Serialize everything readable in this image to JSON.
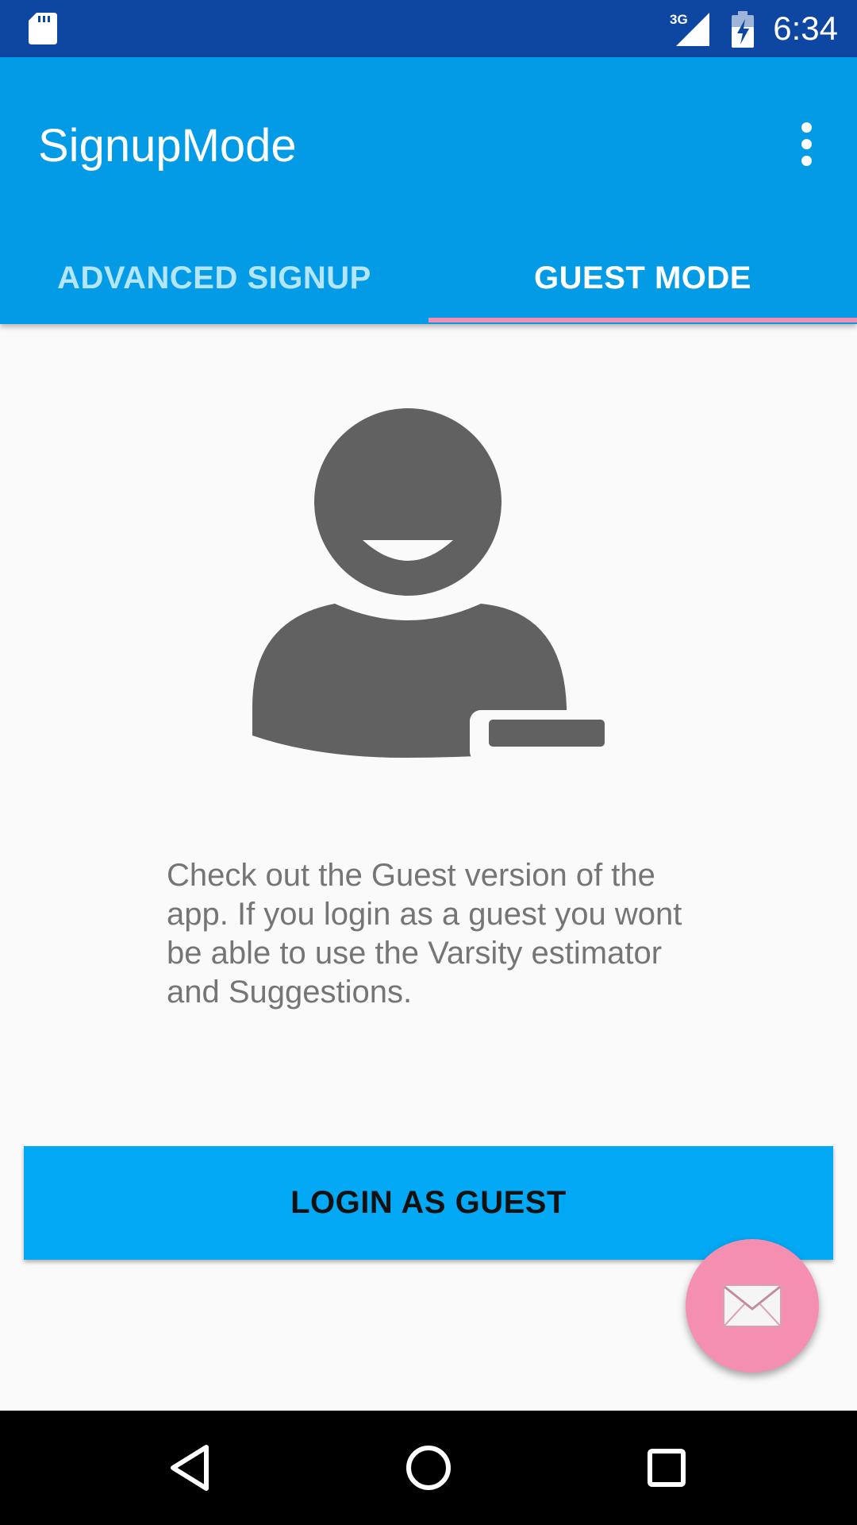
{
  "status_bar": {
    "network_label": "3G",
    "time": "6:34",
    "icons": [
      "sd-card-icon",
      "signal-3g-icon",
      "battery-charging-icon"
    ]
  },
  "app_bar": {
    "title": "SignupMode",
    "menu_icon": "more-vert-icon"
  },
  "tabs": [
    {
      "label": "ADVANCED SIGNUP",
      "selected": false
    },
    {
      "label": "GUEST MODE",
      "selected": true
    }
  ],
  "content": {
    "avatar_icon": "guest-user-icon",
    "description": "Check out the Guest version of the app. If you login as a guest you wont be able to use the Varsity estimator and Suggestions.",
    "login_button_label": "LOGIN AS GUEST",
    "fab_icon": "mail-icon"
  },
  "nav_bar": {
    "icons": [
      "back-icon",
      "home-icon",
      "recents-icon"
    ]
  },
  "colors": {
    "status_bar": "#0d47a1",
    "app_bar": "#039be5",
    "tab_indicator": "#f48fb1",
    "button": "#03a9f4",
    "fab": "#f48fb1",
    "avatar": "#616161"
  }
}
